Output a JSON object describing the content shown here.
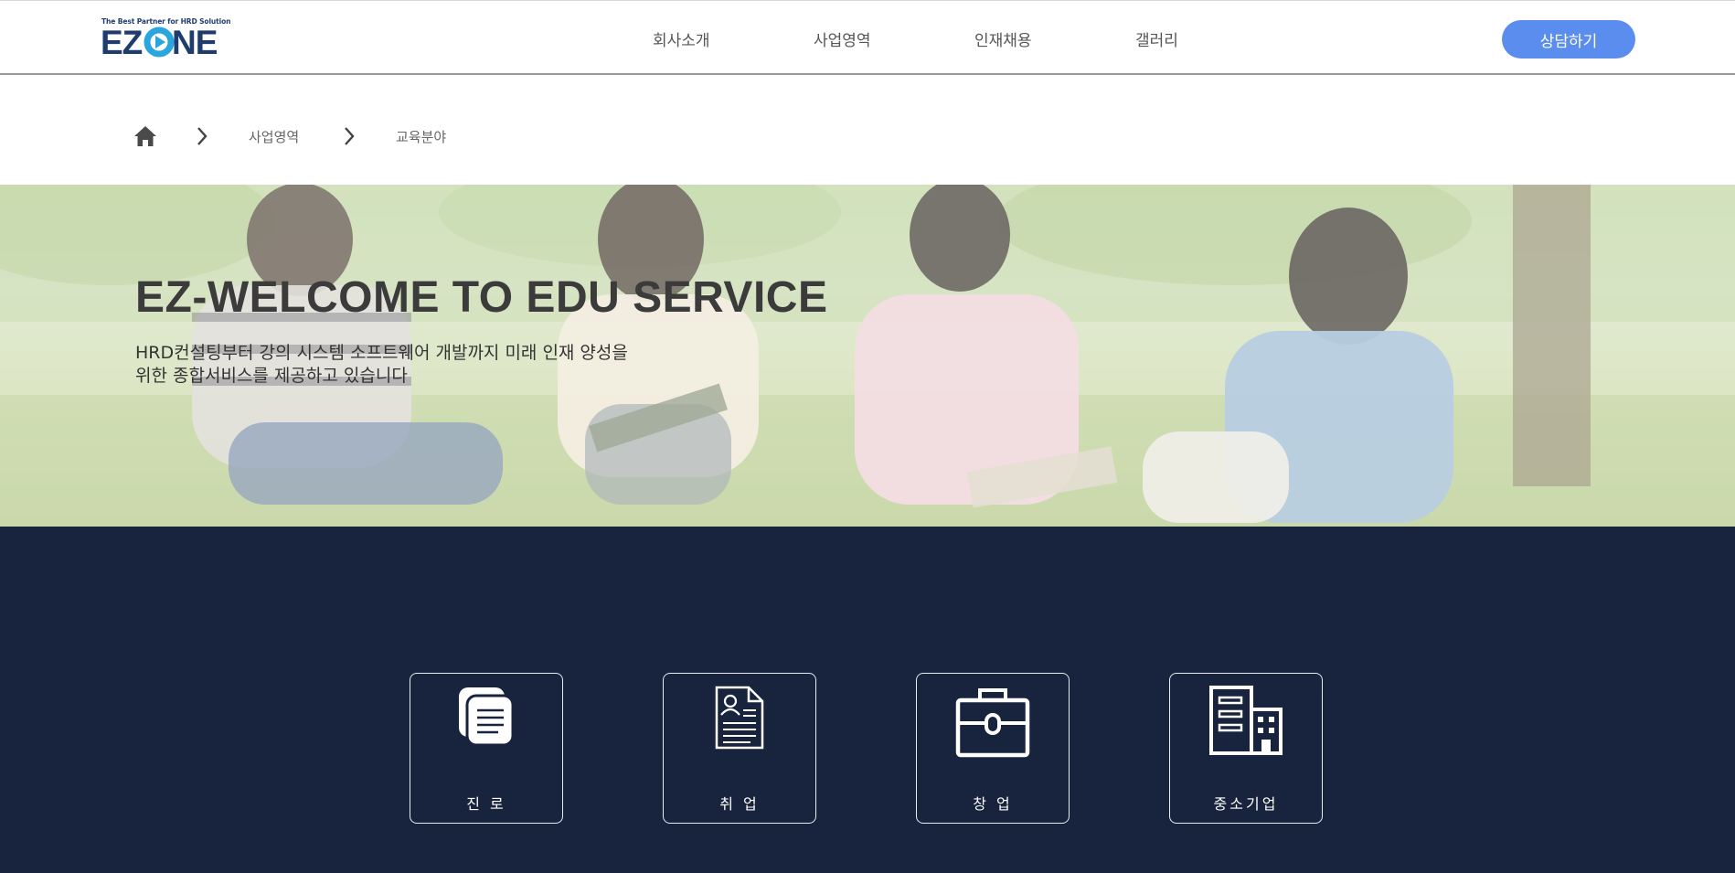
{
  "header": {
    "logo_tagline": "The Best Partner for HRD Solution",
    "logo_text": "EZONE",
    "nav": [
      "회사소개",
      "사업영역",
      "인재채용",
      "갤러리"
    ],
    "consult_button": "상담하기"
  },
  "breadcrumb": {
    "home_icon": "home-icon",
    "items": [
      "사업영역",
      "교육분야"
    ]
  },
  "hero": {
    "title": "EZ-WELCOME TO EDU SERVICE",
    "description_line1": "HRD컨설팅부터 강의 시스템 소프트웨어 개발까지 미래 인재 양성을",
    "description_line2": "위한 종합서비스를 제공하고 있습니다"
  },
  "services": {
    "items": [
      {
        "label": "진 로",
        "icon": "documents-icon"
      },
      {
        "label": "취 업",
        "icon": "resume-icon"
      },
      {
        "label": "창 업",
        "icon": "briefcase-icon"
      },
      {
        "label": "중소기업",
        "icon": "buildings-icon"
      }
    ]
  },
  "colors": {
    "accent": "#5b8def",
    "navy": "#18233d",
    "logo_blue": "#1f3c6e",
    "logo_cyan": "#2aa6df"
  }
}
